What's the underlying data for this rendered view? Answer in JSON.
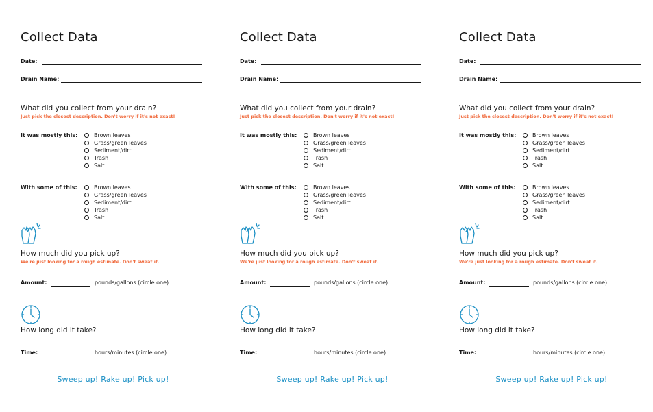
{
  "cards": [
    {
      "title": "Collect Data",
      "date_label": "Date:",
      "drain_label": "Drain Name:",
      "collect_question": "What did you collect from your drain?",
      "collect_hint": "Just pick the closest description. Don't worry if it's not exact!",
      "mostly_label": "It was mostly this:",
      "mostly_options": [
        "Brown leaves",
        "Grass/green leaves",
        "Sediment/dirt",
        "Trash",
        "Salt"
      ],
      "some_label": "With some of this:",
      "some_options": [
        "Brown leaves",
        "Grass/green leaves",
        "Sediment/dirt",
        "Trash",
        "Salt"
      ],
      "amount_question": "How much did you pick up?",
      "amount_hint": "We're just looking for a rough estimate. Don't sweat it.",
      "amount_label": "Amount:",
      "amount_units": "pounds/gallons (circle one)",
      "time_question": "How long did it take?",
      "time_label": "Time:",
      "time_units": "hours/minutes (circle one)",
      "footer": "Sweep up! Rake up! Pick up!",
      "icons": {
        "gloves": "gloves-icon",
        "clock": "clock-icon"
      }
    },
    {
      "title": "Collect Data",
      "date_label": "Date:",
      "drain_label": "Drain Name:",
      "collect_question": "What did you collect from your drain?",
      "collect_hint": "Just pick the closest description. Don't worry if it's not exact!",
      "mostly_label": "It was mostly this:",
      "mostly_options": [
        "Brown leaves",
        "Grass/green leaves",
        "Sediment/dirt",
        "Trash",
        "Salt"
      ],
      "some_label": "With some of this:",
      "some_options": [
        "Brown leaves",
        "Grass/green leaves",
        "Sediment/dirt",
        "Trash",
        "Salt"
      ],
      "amount_question": "How much did you pick up?",
      "amount_hint": "We're just looking for a rough estimate. Don't sweat it.",
      "amount_label": "Amount:",
      "amount_units": "pounds/gallons (circle one)",
      "time_question": "How long did it take?",
      "time_label": "Time:",
      "time_units": "hours/minutes (circle one)",
      "footer": "Sweep up! Rake up! Pick up!",
      "icons": {
        "gloves": "gloves-icon",
        "clock": "clock-icon"
      }
    },
    {
      "title": "Collect Data",
      "date_label": "Date:",
      "drain_label": "Drain Name:",
      "collect_question": "What did you collect from your drain?",
      "collect_hint": "Just pick the closest description. Don't worry if it's not exact!",
      "mostly_label": "It was mostly this:",
      "mostly_options": [
        "Brown leaves",
        "Grass/green leaves",
        "Sediment/dirt",
        "Trash",
        "Salt"
      ],
      "some_label": "With some of this:",
      "some_options": [
        "Brown leaves",
        "Grass/green leaves",
        "Sediment/dirt",
        "Trash",
        "Salt"
      ],
      "amount_question": "How much did you pick up?",
      "amount_hint": "We're just looking for a rough estimate. Don't sweat it.",
      "amount_label": "Amount:",
      "amount_units": "pounds/gallons (circle one)",
      "time_question": "How long did it take?",
      "time_label": "Time:",
      "time_units": "hours/minutes (circle one)",
      "footer": "Sweep up! Rake up! Pick up!",
      "icons": {
        "gloves": "gloves-icon",
        "clock": "clock-icon"
      }
    }
  ],
  "colors": {
    "accent_orange": "#f06b3e",
    "accent_blue": "#1a8fc4",
    "text": "#1a1a1a"
  }
}
